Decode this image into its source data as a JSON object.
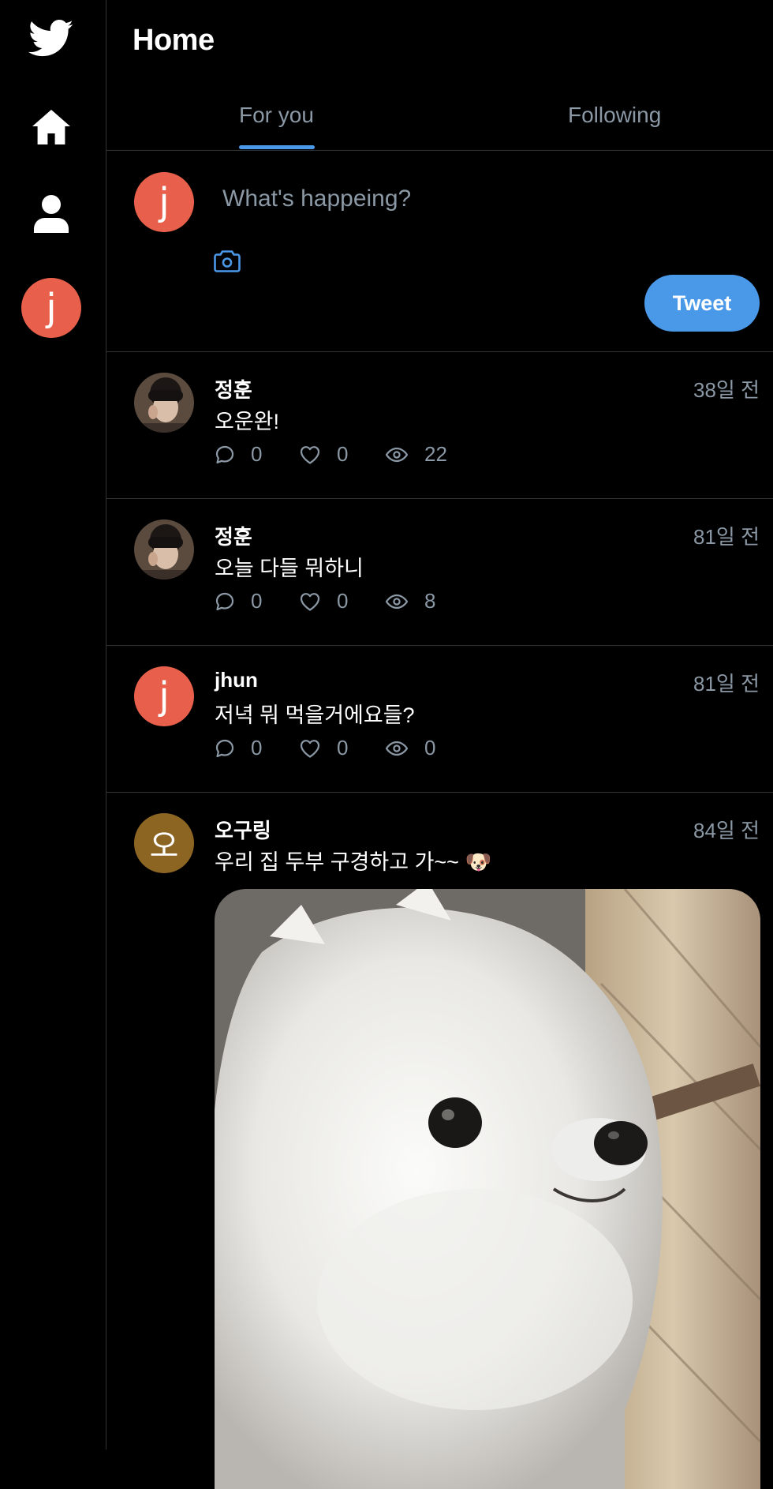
{
  "sidebar": {
    "logo_icon": "twitter-bird-icon",
    "items": [
      {
        "icon": "home-icon"
      },
      {
        "icon": "profile-icon"
      },
      {
        "icon": "user-avatar",
        "letter": "j",
        "color": "#e8604b"
      }
    ]
  },
  "header": {
    "title": "Home"
  },
  "tabs": [
    {
      "label": "For you",
      "active": true
    },
    {
      "label": "Following",
      "active": false
    }
  ],
  "composer": {
    "avatar_letter": "j",
    "avatar_color": "#e8604b",
    "placeholder": "What's happeing?",
    "camera_icon": "camera-icon",
    "button_label": "Tweet"
  },
  "colors": {
    "accent": "#4a99e9",
    "muted": "#8b98a5",
    "border": "#2f3336",
    "background": "#000000"
  },
  "posts": [
    {
      "name": "정훈",
      "time": "38일 전",
      "text": "오운완!",
      "avatar": "photo",
      "comments": "0",
      "likes": "0",
      "views": "22"
    },
    {
      "name": "정훈",
      "time": "81일 전",
      "text": "오늘 다들 뭐하니",
      "avatar": "photo",
      "comments": "0",
      "likes": "0",
      "views": "8"
    },
    {
      "name": "jhun",
      "time": "81일 전",
      "text": "저녁 뭐 먹을거에요들?",
      "avatar_letter": "j",
      "avatar_color": "#e8604b",
      "comments": "0",
      "likes": "0",
      "views": "0"
    },
    {
      "name": "오구링",
      "time": "84일 전",
      "text": "우리 집 두부 구경하고 가~~ 🐶",
      "avatar_letter": "오",
      "avatar_color": "#8c6523",
      "image": "white-pomeranian-photo"
    }
  ]
}
